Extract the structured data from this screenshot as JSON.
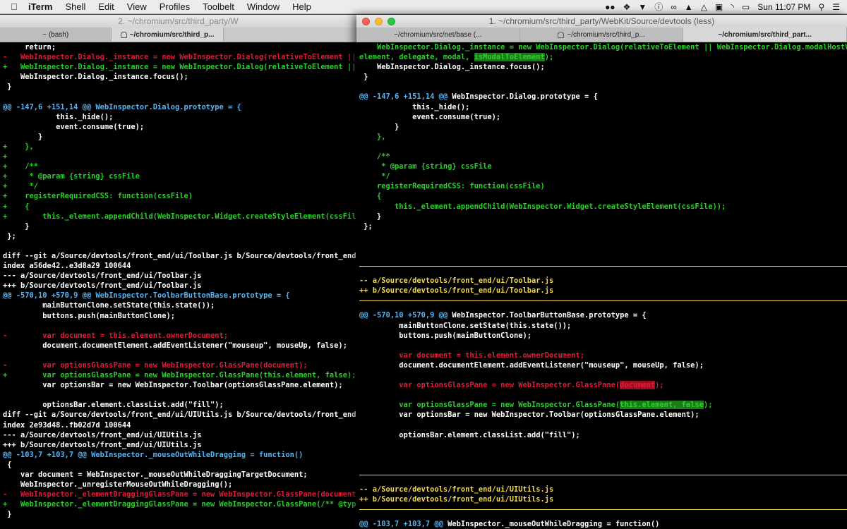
{
  "menubar": {
    "apple": "",
    "items": [
      "iTerm",
      "Shell",
      "Edit",
      "View",
      "Profiles",
      "Toolbelt",
      "Window",
      "Help"
    ],
    "clock": "Sun 11:07 PM"
  },
  "win2": {
    "title": "2. ~/chromium/src/third_party/W",
    "tabs": [
      "~ (bash)",
      "~/chromium/src/third_p..."
    ],
    "lines": [
      {
        "cls": "",
        "t": "     return;"
      },
      {
        "cls": "r",
        "t": "-   WebInspector.Dialog._instance = new WebInspector.Dialog(relativeToElement || WebI"
      },
      {
        "cls": "g",
        "t": "+   WebInspector.Dialog._instance = new WebInspector.Dialog(relativeToElement || WebI"
      },
      {
        "cls": "",
        "t": "    WebInspector.Dialog._instance.focus();"
      },
      {
        "cls": "",
        "t": " }"
      },
      {
        "cls": "",
        "t": ""
      },
      {
        "cls": "c",
        "t": "@@ -147,6 +151,14 @@ WebInspector.Dialog.prototype = {"
      },
      {
        "cls": "",
        "t": "            this._hide();"
      },
      {
        "cls": "",
        "t": "            event.consume(true);"
      },
      {
        "cls": "",
        "t": "        }"
      },
      {
        "cls": "g",
        "t": "+    },"
      },
      {
        "cls": "g",
        "t": "+"
      },
      {
        "cls": "g",
        "t": "+    /**"
      },
      {
        "cls": "g",
        "t": "+     * @param {string} cssFile"
      },
      {
        "cls": "g",
        "t": "+     */"
      },
      {
        "cls": "g",
        "t": "+    registerRequiredCSS: function(cssFile)"
      },
      {
        "cls": "g",
        "t": "+    {"
      },
      {
        "cls": "g",
        "t": "+        this._element.appendChild(WebInspector.Widget.createStyleElement(cssFile));"
      },
      {
        "cls": "",
        "t": "     }"
      },
      {
        "cls": "",
        "t": " };"
      },
      {
        "cls": "",
        "t": ""
      },
      {
        "cls": "",
        "t": "diff --git a/Source/devtools/front_end/ui/Toolbar.js b/Source/devtools/front_end/ui/To"
      },
      {
        "cls": "",
        "t": "index a56de42..e3d8a29 100644"
      },
      {
        "cls": "",
        "t": "--- a/Source/devtools/front_end/ui/Toolbar.js"
      },
      {
        "cls": "",
        "t": "+++ b/Source/devtools/front_end/ui/Toolbar.js"
      },
      {
        "cls": "c",
        "t": "@@ -570,10 +570,9 @@ WebInspector.ToolbarButtonBase.prototype = {"
      },
      {
        "cls": "",
        "t": "         mainButtonClone.setState(this.state());"
      },
      {
        "cls": "",
        "t": "         buttons.push(mainButtonClone);"
      },
      {
        "cls": "",
        "t": ""
      },
      {
        "cls": "r",
        "t": "-        var document = this.element.ownerDocument;"
      },
      {
        "cls": "",
        "t": "         document.documentElement.addEventListener(\"mouseup\", mouseUp, false);"
      },
      {
        "cls": "",
        "t": ""
      },
      {
        "cls": "r",
        "t": "-        var optionsGlassPane = new WebInspector.GlassPane(document);"
      },
      {
        "cls": "g",
        "t": "+        var optionsGlassPane = new WebInspector.GlassPane(this.element, false);"
      },
      {
        "cls": "",
        "t": "         var optionsBar = new WebInspector.Toolbar(optionsGlassPane.element);"
      },
      {
        "cls": "",
        "t": ""
      },
      {
        "cls": "",
        "t": "         optionsBar.element.classList.add(\"fill\");"
      },
      {
        "cls": "",
        "t": "diff --git a/Source/devtools/front_end/ui/UIUtils.js b/Source/devtools/front_end/ui/UI"
      },
      {
        "cls": "",
        "t": "index 2e93d48..fb02d7d 100644"
      },
      {
        "cls": "",
        "t": "--- a/Source/devtools/front_end/ui/UIUtils.js"
      },
      {
        "cls": "",
        "t": "+++ b/Source/devtools/front_end/ui/UIUtils.js"
      },
      {
        "cls": "c",
        "t": "@@ -103,7 +103,7 @@ WebInspector._mouseOutWhileDragging = function()"
      },
      {
        "cls": "",
        "t": " {"
      },
      {
        "cls": "",
        "t": "    var document = WebInspector._mouseOutWhileDraggingTargetDocument;"
      },
      {
        "cls": "",
        "t": "    WebInspector._unregisterMouseOutWhileDragging();"
      },
      {
        "cls": "r",
        "t": "-   WebInspector._elementDraggingGlassPane = new WebInspector.GlassPane(document);"
      },
      {
        "cls": "g",
        "t": "+   WebInspector._elementDraggingGlassPane = new WebInspector.GlassPane(/** @type {!E"
      },
      {
        "cls": "",
        "t": " }"
      }
    ]
  },
  "win1": {
    "title": "1. ~/chromium/src/third_party/WebKit/Source/devtools (less)",
    "tabs": [
      "~/chromium/src/net/base (...",
      "~/chromium/src/third_p...",
      "~/chromium/src/third_part..."
    ]
  }
}
